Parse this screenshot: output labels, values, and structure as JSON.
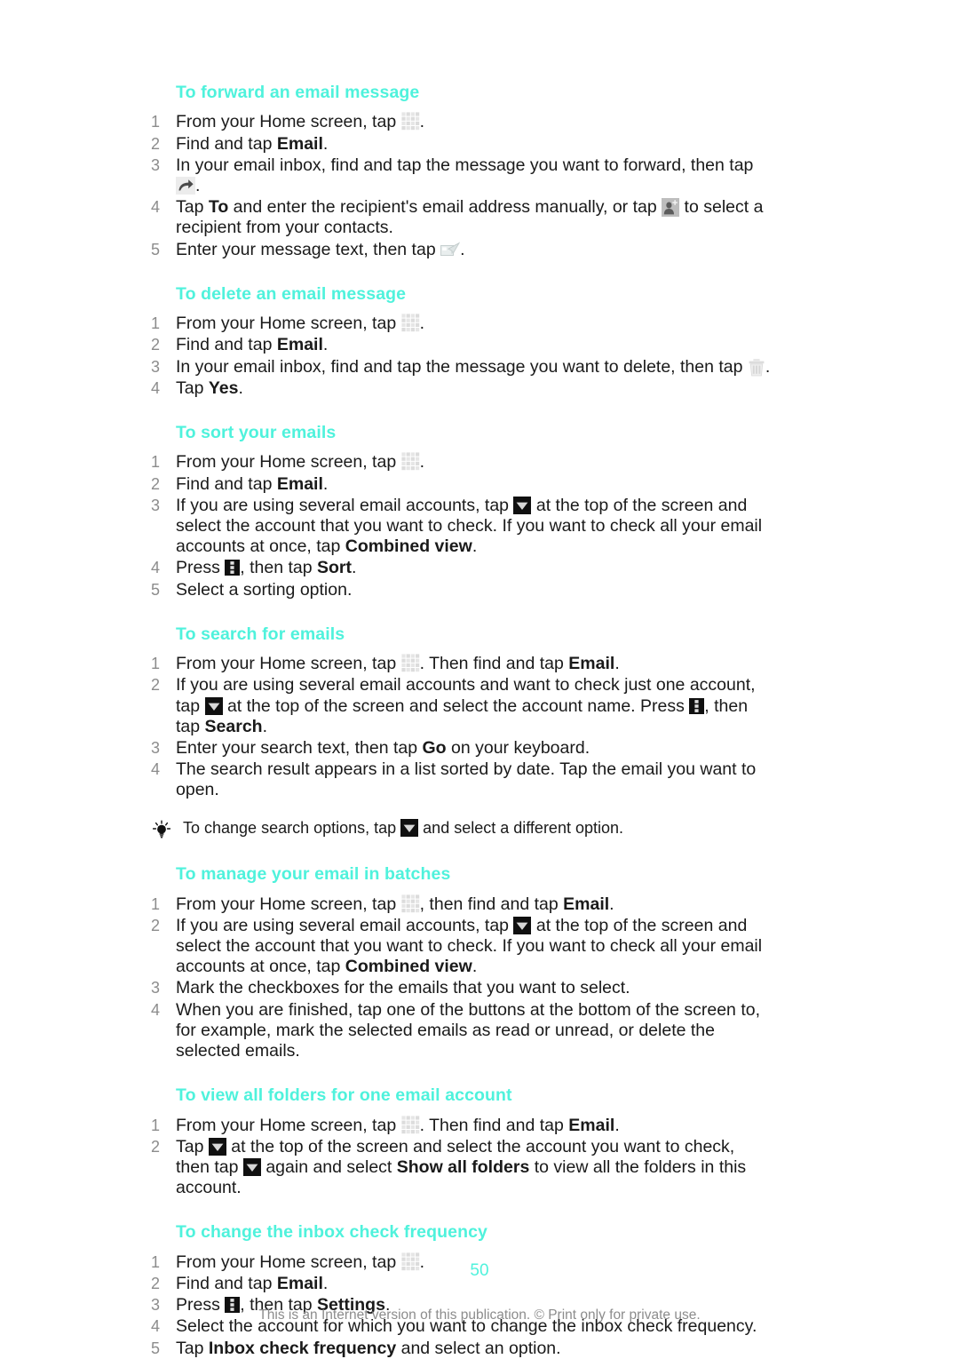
{
  "document": {
    "page_number": "50",
    "footer_note": "This is an Internet version of this publication. © Print only for private use.",
    "heading_color": "#4FF2DC",
    "step_number_color": "#8C8C8C",
    "body_color": "#1A1A1A"
  },
  "icons": {
    "grid": "app-drawer-grid-icon",
    "forward": "forward-arrow-icon",
    "contact": "add-contact-icon",
    "send": "send-email-icon",
    "trash": "delete-trash-icon",
    "dropdown": "dropdown-triangle-icon",
    "menu": "overflow-menu-icon",
    "bulb": "tip-lightbulb-icon"
  },
  "sections": [
    {
      "heading": "To forward an email message",
      "steps": [
        {
          "num": "1",
          "parts": [
            {
              "t": "From your Home screen, tap "
            },
            {
              "icon": "grid"
            },
            {
              "t": "."
            }
          ]
        },
        {
          "num": "2",
          "parts": [
            {
              "t": "Find and tap "
            },
            {
              "b": "Email"
            },
            {
              "t": "."
            }
          ]
        },
        {
          "num": "3",
          "parts": [
            {
              "t": "In your email inbox, find and tap the message you want to forward, then tap "
            },
            {
              "icon": "forward"
            },
            {
              "t": "."
            }
          ]
        },
        {
          "num": "4",
          "parts": [
            {
              "t": "Tap "
            },
            {
              "b": "To"
            },
            {
              "t": " and enter the recipient's email address manually, or tap "
            },
            {
              "icon": "contact"
            },
            {
              "t": " to select a recipient from your contacts."
            }
          ]
        },
        {
          "num": "5",
          "parts": [
            {
              "t": "Enter your message text, then tap "
            },
            {
              "icon": "send"
            },
            {
              "t": "."
            }
          ]
        }
      ]
    },
    {
      "heading": "To delete an email message",
      "steps": [
        {
          "num": "1",
          "parts": [
            {
              "t": "From your Home screen, tap "
            },
            {
              "icon": "grid"
            },
            {
              "t": "."
            }
          ]
        },
        {
          "num": "2",
          "parts": [
            {
              "t": "Find and tap "
            },
            {
              "b": "Email"
            },
            {
              "t": "."
            }
          ]
        },
        {
          "num": "3",
          "parts": [
            {
              "t": "In your email inbox, find and tap the message you want to delete, then tap "
            },
            {
              "icon": "trash"
            },
            {
              "t": "."
            }
          ]
        },
        {
          "num": "4",
          "parts": [
            {
              "t": "Tap "
            },
            {
              "b": "Yes"
            },
            {
              "t": "."
            }
          ]
        }
      ]
    },
    {
      "heading": "To sort your emails",
      "steps": [
        {
          "num": "1",
          "parts": [
            {
              "t": "From your Home screen, tap "
            },
            {
              "icon": "grid"
            },
            {
              "t": "."
            }
          ]
        },
        {
          "num": "2",
          "parts": [
            {
              "t": "Find and tap "
            },
            {
              "b": "Email"
            },
            {
              "t": "."
            }
          ]
        },
        {
          "num": "3",
          "parts": [
            {
              "t": "If you are using several email accounts, tap "
            },
            {
              "icon": "dropdown"
            },
            {
              "t": " at the top of the screen and select the account that you want to check. If you want to check all your email accounts at once, tap "
            },
            {
              "b": "Combined view"
            },
            {
              "t": "."
            }
          ]
        },
        {
          "num": "4",
          "parts": [
            {
              "t": "Press "
            },
            {
              "icon": "menu"
            },
            {
              "t": ", then tap "
            },
            {
              "b": "Sort"
            },
            {
              "t": "."
            }
          ]
        },
        {
          "num": "5",
          "parts": [
            {
              "t": "Select a sorting option."
            }
          ]
        }
      ]
    },
    {
      "heading": "To search for emails",
      "steps": [
        {
          "num": "1",
          "parts": [
            {
              "t": "From your Home screen, tap "
            },
            {
              "icon": "grid"
            },
            {
              "t": ". Then find and tap "
            },
            {
              "b": "Email"
            },
            {
              "t": "."
            }
          ]
        },
        {
          "num": "2",
          "parts": [
            {
              "t": "If you are using several email accounts and want to check just one account, tap "
            },
            {
              "icon": "dropdown"
            },
            {
              "t": " at the top of the screen and select the account name. Press "
            },
            {
              "icon": "menu"
            },
            {
              "t": ", then tap "
            },
            {
              "b": "Search"
            },
            {
              "t": "."
            }
          ]
        },
        {
          "num": "3",
          "parts": [
            {
              "t": "Enter your search text, then tap "
            },
            {
              "b": "Go"
            },
            {
              "t": " on your keyboard."
            }
          ]
        },
        {
          "num": "4",
          "parts": [
            {
              "t": "The search result appears in a list sorted by date. Tap the email you want to open."
            }
          ]
        }
      ],
      "tip": {
        "parts": [
          {
            "t": "To change search options, tap "
          },
          {
            "icon": "dropdown"
          },
          {
            "t": " and select a different option."
          }
        ]
      }
    },
    {
      "heading": "To manage your email in batches",
      "steps": [
        {
          "num": "1",
          "parts": [
            {
              "t": "From your Home screen, tap "
            },
            {
              "icon": "grid"
            },
            {
              "t": ", then find and tap "
            },
            {
              "b": "Email"
            },
            {
              "t": "."
            }
          ]
        },
        {
          "num": "2",
          "parts": [
            {
              "t": "If you are using several email accounts, tap "
            },
            {
              "icon": "dropdown"
            },
            {
              "t": " at the top of the screen and select the account that you want to check. If you want to check all your email accounts at once, tap "
            },
            {
              "b": "Combined view"
            },
            {
              "t": "."
            }
          ]
        },
        {
          "num": "3",
          "parts": [
            {
              "t": "Mark the checkboxes for the emails that you want to select."
            }
          ]
        },
        {
          "num": "4",
          "parts": [
            {
              "t": "When you are finished, tap one of the buttons at the bottom of the screen to, for example, mark the selected emails as read or unread, or delete the selected emails."
            }
          ]
        }
      ]
    },
    {
      "heading": "To view all folders for one email account",
      "steps": [
        {
          "num": "1",
          "parts": [
            {
              "t": "From your Home screen, tap "
            },
            {
              "icon": "grid"
            },
            {
              "t": ". Then find and tap "
            },
            {
              "b": "Email"
            },
            {
              "t": "."
            }
          ]
        },
        {
          "num": "2",
          "parts": [
            {
              "t": "Tap "
            },
            {
              "icon": "dropdown"
            },
            {
              "t": " at the top of the screen and select the account you want to check, then tap "
            },
            {
              "icon": "dropdown"
            },
            {
              "t": " again and select "
            },
            {
              "b": "Show all folders"
            },
            {
              "t": " to view all the folders in this account."
            }
          ]
        }
      ]
    },
    {
      "heading": "To change the inbox check frequency",
      "steps": [
        {
          "num": "1",
          "parts": [
            {
              "t": "From your Home screen, tap "
            },
            {
              "icon": "grid"
            },
            {
              "t": "."
            }
          ]
        },
        {
          "num": "2",
          "parts": [
            {
              "t": "Find and tap "
            },
            {
              "b": "Email"
            },
            {
              "t": "."
            }
          ]
        },
        {
          "num": "3",
          "parts": [
            {
              "t": "Press "
            },
            {
              "icon": "menu"
            },
            {
              "t": ", then tap "
            },
            {
              "b": "Settings"
            },
            {
              "t": "."
            }
          ]
        },
        {
          "num": "4",
          "parts": [
            {
              "t": "Select the account for which you want to change the inbox check frequency."
            }
          ]
        },
        {
          "num": "5",
          "parts": [
            {
              "t": "Tap "
            },
            {
              "b": "Inbox check frequency"
            },
            {
              "t": " and select an option."
            }
          ]
        }
      ]
    }
  ]
}
